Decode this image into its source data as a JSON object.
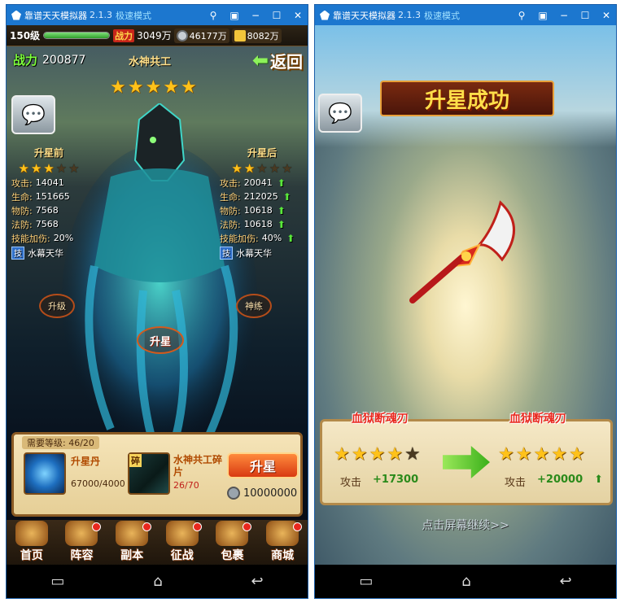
{
  "emulator": {
    "title": "靠谱天天模拟器",
    "version": "2.1.3",
    "mode": "极速模式",
    "controls": [
      "pin-icon",
      "restore-icon",
      "minimize-icon",
      "maximize-icon",
      "close-icon"
    ]
  },
  "left": {
    "topbar": {
      "level": "150级",
      "exp_fraction": 1.0,
      "power_badge": "战力",
      "power": "3049万",
      "silver": "46177万",
      "gold": "8082万"
    },
    "power_label": "战力",
    "power_value": "200877",
    "hero_name": "水神共工",
    "hero_stars": 5,
    "back_label": "返回",
    "pre": {
      "header": "升星前",
      "stars": 3,
      "stats": [
        {
          "k": "攻击:",
          "v": "14041"
        },
        {
          "k": "生命:",
          "v": "151665"
        },
        {
          "k": "物防:",
          "v": "7568"
        },
        {
          "k": "法防:",
          "v": "7568"
        },
        {
          "k": "技能加伤:",
          "v": "20%"
        }
      ],
      "skill_tag": "技",
      "skill": "水幕天华"
    },
    "post": {
      "header": "升星后",
      "stars": 2,
      "stats": [
        {
          "k": "攻击:",
          "v": "20041"
        },
        {
          "k": "生命:",
          "v": "212025"
        },
        {
          "k": "物防:",
          "v": "10618"
        },
        {
          "k": "法防:",
          "v": "10618"
        },
        {
          "k": "技能加伤:",
          "v": "40%"
        }
      ],
      "skill_tag": "技",
      "skill": "水幕天华"
    },
    "side_left": "升级",
    "side_right": "神练",
    "center_button": "升星",
    "panel": {
      "requirement": "需要等级: 46/20",
      "item1_name": "升星丹",
      "item1_qty": "67000/4000",
      "item2_tag": "碎",
      "item2_name": "水神共工碎片",
      "item2_qty": "26/70",
      "upgrade_button": "升星",
      "cost": "10000000"
    },
    "menu": [
      {
        "label": "首页",
        "dot": false
      },
      {
        "label": "阵容",
        "dot": true
      },
      {
        "label": "副本",
        "dot": true
      },
      {
        "label": "征战",
        "dot": true
      },
      {
        "label": "包裹",
        "dot": true
      },
      {
        "label": "商城",
        "dot": true
      }
    ]
  },
  "right": {
    "banner": "升星成功",
    "weapon_before": "血狱断魂刃",
    "weapon_after": "血狱断魂刃",
    "stars_before": 4,
    "stars_after": 5,
    "atk_label": "攻击",
    "atk_before": "+17300",
    "atk_after": "+20000",
    "continue": "点击屏幕继续>>"
  }
}
